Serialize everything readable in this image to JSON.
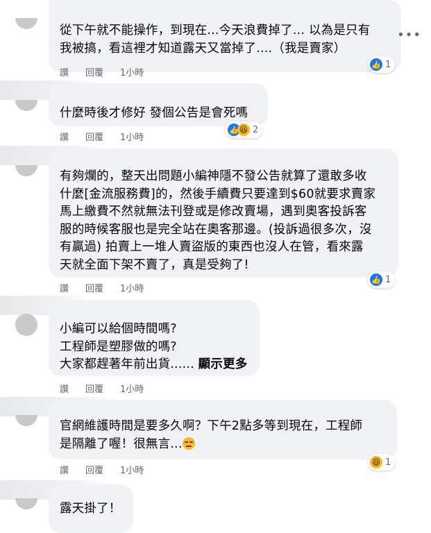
{
  "comments": [
    {
      "lines": [
        "從下午就不能操作，到現在...今天浪費掉了... 以為是只有",
        "我被搞，看這裡才知道露天又當掉了....（我是賣家）"
      ],
      "like_label": "讚",
      "reply_label": "回覆",
      "time": "1小時",
      "reactions": [
        "like"
      ],
      "reaction_count": "1"
    },
    {
      "lines": [
        "什麼時後才修好 發個公告是會死嗎"
      ],
      "like_label": "讚",
      "reply_label": "回覆",
      "time": "1小時",
      "reactions": [
        "like",
        "haha"
      ],
      "reaction_count": "2"
    },
    {
      "lines": [
        "有夠爛的，整天出問題小編神隱不發公告就算了還敢多收",
        "什麼[金流服務費]的，然後手續費只要達到$60就要求賣家",
        "馬上繳費不然就無法刊登或是修改賣場，遇到奧客投訴客",
        "服的時候客服也是完全站在奧客那邊。(投訴過很多次，沒",
        "有贏過) 拍賣上一堆人賣盜版的東西也沒人在管，看來露",
        "天就全面下架不賣了，真是受夠了!"
      ],
      "like_label": "讚",
      "reply_label": "回覆",
      "time": "1小時",
      "reactions": [
        "like"
      ],
      "reaction_count": "1"
    },
    {
      "lines": [
        "小編可以給個時間嗎?",
        "工程師是塑膠做的嗎?",
        "大家都趕著年前出貨......"
      ],
      "see_more": "顯示更多",
      "like_label": "讚",
      "reply_label": "回覆",
      "time": "1小時"
    },
    {
      "lines": [
        "官網維護時間是要多久啊？下午2點多等到現在，工程師",
        "是隔離了喔！很無言..."
      ],
      "like_label": "讚",
      "reply_label": "回覆",
      "time": "1小時",
      "reactions": [
        "haha"
      ],
      "reaction_count": "1"
    },
    {
      "lines": [
        "露天掛了！"
      ]
    }
  ],
  "menu_icon": "more-horizontal-icon",
  "colors": {
    "bubble": "#f0f2f5",
    "meta": "#65676b",
    "like": "#1877f2",
    "haha": "#f7b928"
  }
}
